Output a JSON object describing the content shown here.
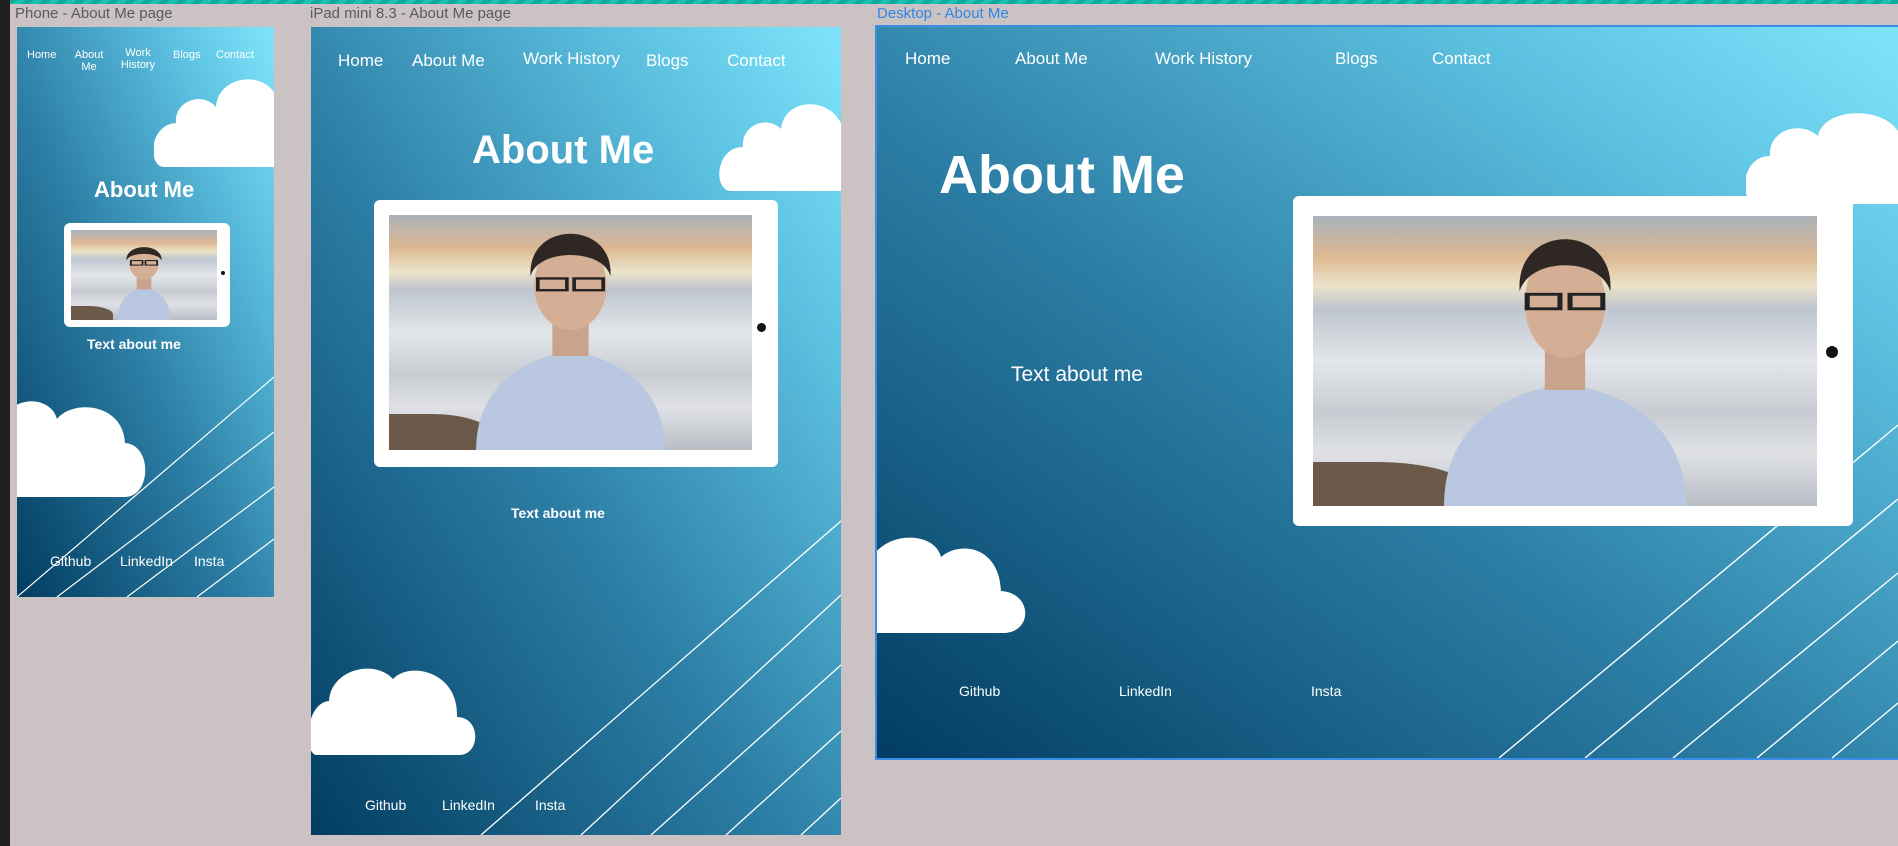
{
  "frames": {
    "phone": {
      "label": "Phone - About Me page",
      "nav": [
        "Home",
        "About Me",
        "Work History",
        "Blogs",
        "Contact"
      ],
      "title": "About Me",
      "text": "Text about me",
      "footer": [
        "Github",
        "LinkedIn",
        "Insta"
      ]
    },
    "ipad": {
      "label": "iPad mini 8.3 - About Me page",
      "nav": [
        "Home",
        "About Me",
        "Work History",
        "Blogs",
        "Contact"
      ],
      "title": "About Me",
      "text": "Text about me",
      "footer": [
        "Github",
        "LinkedIn",
        "Insta"
      ]
    },
    "desktop": {
      "label": "Desktop - About Me",
      "nav": [
        "Home",
        "About Me",
        "Work History",
        "Blogs",
        "Contact"
      ],
      "title": "About Me",
      "text": "Text about me",
      "footer": [
        "Github",
        "LinkedIn",
        "Insta"
      ]
    }
  },
  "colors": {
    "canvas": "#cbc3c3",
    "gradient_dark": "#023d61",
    "gradient_light": "#7fe4fb",
    "selection": "#3a8ee8"
  }
}
